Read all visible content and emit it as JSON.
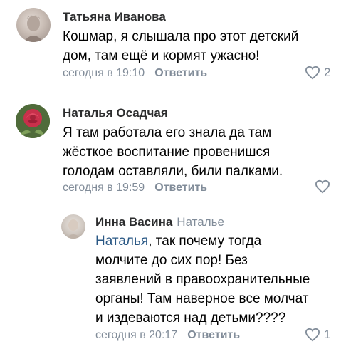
{
  "comments": [
    {
      "author": "Татьяна Иванова",
      "text_lines": [
        "Кошмар,  я слышала про этот детский",
        "дом,  там  ещё  и кормят ужасно!"
      ],
      "time": "сегодня в 19:10",
      "reply_label": "Ответить",
      "likes": "2"
    },
    {
      "author": "Наталья Осадчая",
      "text_lines": [
        "Я там работала его знала да там",
        "жёсткое воспитание провенишся",
        "голодам оставляли, били палками."
      ],
      "time": "сегодня в 19:59",
      "reply_label": "Ответить",
      "likes": ""
    },
    {
      "author": "Инна Васина",
      "reply_to": "Наталье",
      "mention": "Наталья",
      "text_first_rest": ", так почему тогда",
      "text_lines": [
        "молчите до сих пор! Без",
        "заявлений в правоохранительные",
        "органы! Там наверное все молчат",
        "и издеваются над детьми????"
      ],
      "time": "сегодня в 20:17",
      "reply_label": "Ответить",
      "likes": "1"
    }
  ],
  "colors": {
    "link": "#2a5885",
    "muted": "#818c99",
    "name": "#2c2d2e"
  }
}
